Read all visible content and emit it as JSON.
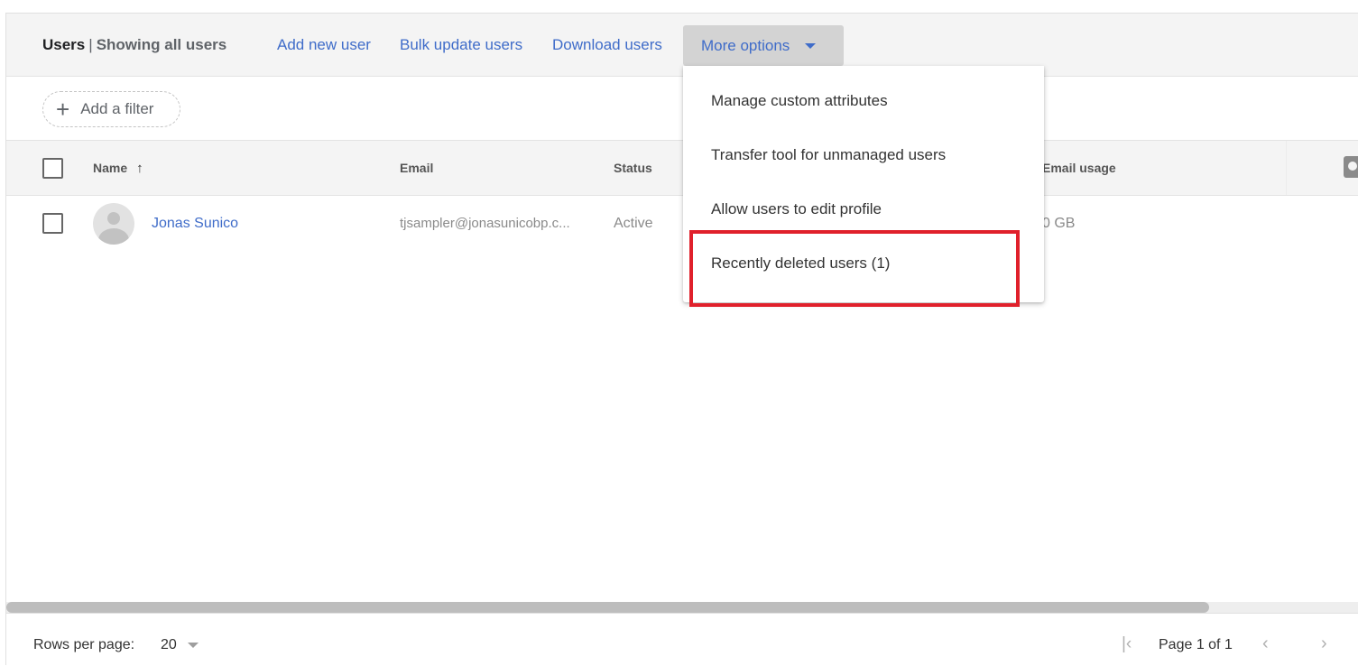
{
  "header": {
    "title_main": "Users",
    "title_sep": "|",
    "title_sub": "Showing all users",
    "links": [
      {
        "label": "Add new user"
      },
      {
        "label": "Bulk update users"
      },
      {
        "label": "Download users"
      }
    ],
    "more_options_label": "More options"
  },
  "filter": {
    "add_filter_label": "Add a filter",
    "plus_glyph": "+"
  },
  "table": {
    "columns": {
      "name": "Name",
      "email": "Email",
      "status": "Status",
      "email_usage": "Email usage"
    },
    "sort": {
      "column": "Name",
      "direction": "ascending",
      "glyph": "↑"
    },
    "rows": [
      {
        "name": "Jonas Sunico",
        "email": "tjsampler@jonasunicobp.c...",
        "status": "Active",
        "email_usage": "0 GB"
      }
    ]
  },
  "menu": {
    "items": [
      {
        "label": "Manage custom attributes"
      },
      {
        "label": "Transfer tool for unmanaged users"
      },
      {
        "label": "Allow users to edit profile"
      },
      {
        "label": "Recently deleted users (1)",
        "highlighted": true
      }
    ],
    "highlight_color": "#e0202b"
  },
  "scrollbar": {
    "horizontal_visible_fraction": 0.89,
    "position_fraction": 0.0
  },
  "footer": {
    "rows_per_page_label": "Rows per page:",
    "rows_per_page_value": "20",
    "page_label": "Page 1 of 1",
    "first_glyph": "|‹",
    "prev_glyph": "‹",
    "next_glyph": "›"
  },
  "colors": {
    "link": "#3f6cc9",
    "header_bg": "#f4f4f4",
    "more_options_bg": "#d3d3d3"
  }
}
